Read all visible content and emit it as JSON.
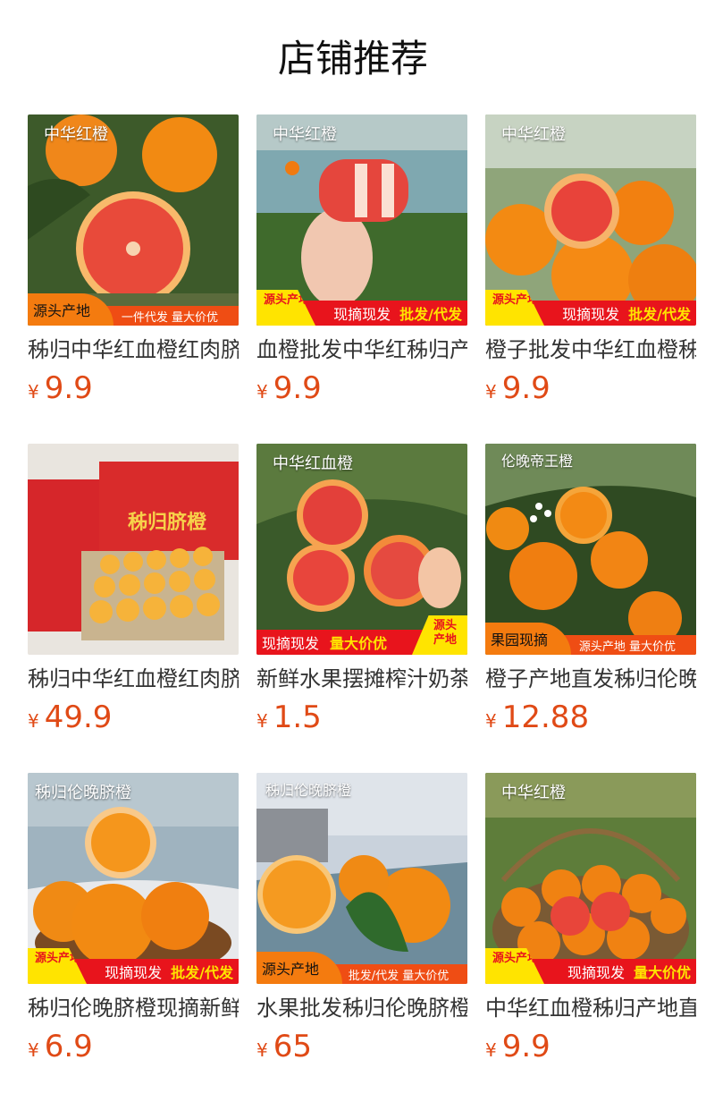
{
  "page": {
    "title": "店铺推荐"
  },
  "colors": {
    "price": "#e04a16",
    "banner_red": "#e8141c",
    "banner_yellow": "#ffe400",
    "tag_orange": "#f47b0f"
  },
  "products": [
    {
      "overlay": "中华红橙",
      "name": "秭归中华红血橙红肉脐橙",
      "currency": "¥",
      "price": "9.9",
      "banner": {
        "style": "A",
        "tag": "源头产地",
        "strip": "一件代发 量大价优"
      }
    },
    {
      "overlay": "中华红橙",
      "name": "血橙批发中华红秭归产地",
      "currency": "¥",
      "price": "9.9",
      "banner": {
        "style": "B",
        "badge": "源头产地",
        "s1": "现摘现发",
        "s2": "批发/代发"
      }
    },
    {
      "overlay": "中华红橙",
      "name": "橙子批发中华红血橙秭归",
      "currency": "¥",
      "price": "9.9",
      "banner": {
        "style": "B",
        "badge": "源头产地",
        "s1": "现摘现发",
        "s2": "批发/代发"
      }
    },
    {
      "overlay": "",
      "box_text": "秭归脐橙",
      "name": "秭归中华红血橙红肉脐橙",
      "currency": "¥",
      "price": "49.9",
      "banner": {
        "style": "none"
      }
    },
    {
      "overlay": "中华红血橙",
      "name": "新鲜水果摆摊榨汁奶茶店",
      "currency": "¥",
      "price": "1.5",
      "banner": {
        "style": "C",
        "badge": "源头产地",
        "s1": "现摘现发",
        "s2": "量大价优"
      }
    },
    {
      "overlay": "伦晚帝王橙",
      "name": "橙子产地直发秭归伦晚脐橙",
      "currency": "¥",
      "price": "12.88",
      "banner": {
        "style": "A",
        "tag": "果园现摘",
        "strip": "源头产地 量大价优"
      }
    },
    {
      "overlay": "秭归伦晚脐橙",
      "name": "秭归伦晚脐橙现摘新鲜水果",
      "currency": "¥",
      "price": "6.9",
      "banner": {
        "style": "B",
        "badge": "源头产地",
        "s1": "现摘现发",
        "s2": "批发/代发"
      }
    },
    {
      "overlay": "秭归伦晚脐橙",
      "name": "水果批发秭归伦晚脐橙整箱",
      "currency": "¥",
      "price": "65",
      "banner": {
        "style": "A",
        "tag": "源头产地",
        "strip": "批发/代发 量大价优"
      }
    },
    {
      "overlay": "中华红橙",
      "name": "中华红血橙秭归产地直发",
      "currency": "¥",
      "price": "9.9",
      "banner": {
        "style": "B",
        "badge": "源头产地",
        "s1": "现摘现发",
        "s2": "量大价优"
      }
    }
  ]
}
